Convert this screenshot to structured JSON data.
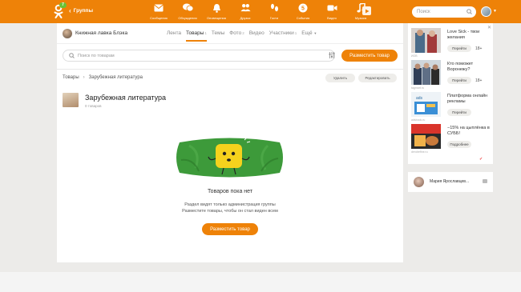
{
  "topbar": {
    "badge": "7",
    "back_label": "Группы",
    "nav": [
      {
        "label": "Сообщения",
        "icon": "envelope-icon"
      },
      {
        "label": "Обсуждения",
        "icon": "chat-bubbles-icon"
      },
      {
        "label": "Оповещения",
        "icon": "bell-icon"
      },
      {
        "label": "Друзья",
        "icon": "friends-icon"
      },
      {
        "label": "Гости",
        "icon": "footprints-icon"
      },
      {
        "label": "События",
        "icon": "events-icon"
      },
      {
        "label": "Видео",
        "icon": "video-camera-icon"
      },
      {
        "label": "Музыка",
        "icon": "music-note-icon"
      }
    ],
    "search_placeholder": "Поиск"
  },
  "group": {
    "name": "Книжная лавка Блэка",
    "tabs": [
      {
        "label": "Лента",
        "count": ""
      },
      {
        "label": "Товары",
        "count": "1"
      },
      {
        "label": "Темы",
        "count": ""
      },
      {
        "label": "Фото",
        "count": "2"
      },
      {
        "label": "Видео",
        "count": ""
      },
      {
        "label": "Участники",
        "count": "1"
      },
      {
        "label": "Ещё",
        "count": ""
      }
    ],
    "active_tab": "Товары"
  },
  "products": {
    "search_placeholder": "Поиск по товарам",
    "place_button": "Разместить товар",
    "breadcrumb_root": "Товары",
    "breadcrumb_current": "Зарубежная литература",
    "delete_button": "Удалить",
    "edit_button": "Редактировать",
    "category_title": "Зарубежная литература",
    "category_count": "0 товаров",
    "empty_title": "Товаров пока нет",
    "empty_line1": "Раздел видят только администрация группы",
    "empty_line2": "Разместите товары, чтобы он стал виден всем",
    "empty_button": "Разместить товар"
  },
  "ads": [
    {
      "title": "Love Sick - твои желания",
      "button": "Перейти",
      "age": "18+",
      "source": "ИОВ"
    },
    {
      "title": "Кто поможет Воронежу?",
      "button": "Перейти",
      "age": "18+",
      "source": "tagmart.ru"
    },
    {
      "title": "Платформа онлайн рекламы",
      "button": "Перейти",
      "age": "",
      "source": "adsbook.ru"
    },
    {
      "title": "−15% на цыплёнка в СУББ!",
      "button": "Подробнее",
      "age": "",
      "source": "dendrefine.ru"
    }
  ],
  "chat": {
    "name": "Мария Ярославцев..."
  },
  "colors": {
    "accent": "#ee8208",
    "badge": "#6bc235"
  }
}
